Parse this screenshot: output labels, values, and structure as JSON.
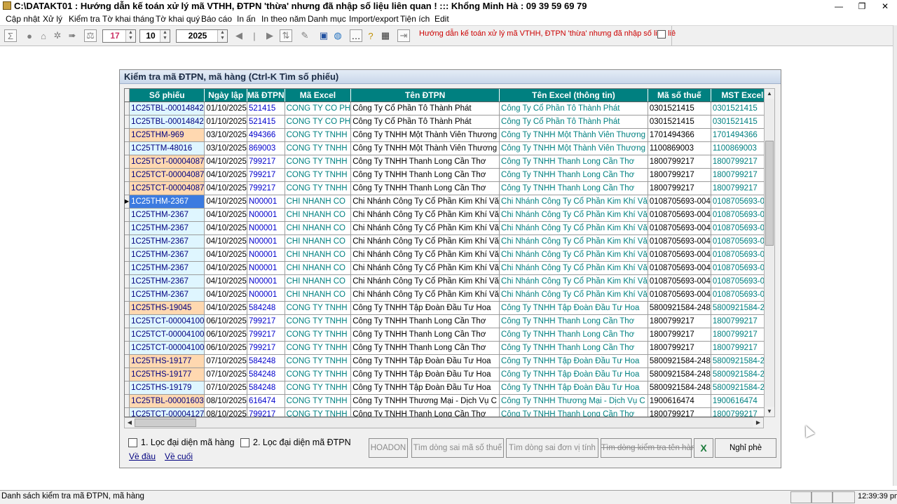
{
  "window": {
    "title": "C:\\DATAKT01 : Hướng dẫn kế toán xử lý mã VTHH, ĐTPN 'thừa' nhưng đã nhập số liệu liên quan ! ::: Khổng Minh Hà : 09 39 59 69 79",
    "minimize": "—",
    "restore": "❐",
    "close": "✕"
  },
  "menu": [
    "Cập nhật",
    "Xử lý",
    "Kiểm tra",
    "Tờ khai tháng",
    "Tờ khai quý",
    "Báo cáo",
    "In ấn",
    "In theo năm",
    "Danh mục",
    "Import/export",
    "Tiện ích",
    "Edit"
  ],
  "toolbar": {
    "day": "17",
    "month": "10",
    "year": "2025",
    "hint": "Hướng dẫn kế toán xử lý mã VTHH, ĐTPN 'thừa' nhưng đã nhập số liệu liê"
  },
  "dialog": {
    "title": "Kiểm tra mã ĐTPN, mã hàng (Ctrl-K Tìm số phiếu)",
    "columns": [
      "Số phiếu",
      "Ngày lập",
      "Mã ĐTPN",
      "Mã Excel",
      "Tên ĐTPN",
      "Tên Excel (thông tin)",
      "Mã số thuế",
      "MST Excel"
    ],
    "rows": [
      [
        "1C25TBL-00014842",
        "01/10/2025",
        "521415",
        "CONG TY CO PH",
        "Công Ty Cổ Phần Tô Thành Phát",
        "Công Ty Cổ Phần Tô Thành Phát",
        "0301521415",
        "0301521415"
      ],
      [
        "1C25TBL-00014842",
        "01/10/2025",
        "521415",
        "CONG TY CO PH",
        "Công Ty Cổ Phần Tô Thành Phát",
        "Công Ty Cổ Phần Tô Thành Phát",
        "0301521415",
        "0301521415"
      ],
      [
        "1C25THM-969",
        "03/10/2025",
        "494366",
        "CONG TY TNHH",
        "Công Ty TNHH Một Thành Viên Thương",
        "Công Ty TNHH Một Thành Viên Thương",
        "1701494366",
        "1701494366"
      ],
      [
        "1C25TTM-48016",
        "03/10/2025",
        "869003",
        "CONG TY TNHH",
        "Công Ty TNHH Một Thành Viên Thương",
        "Công Ty TNHH Một Thành Viên Thương",
        "1100869003",
        "1100869003"
      ],
      [
        "1C25TCT-00004087",
        "04/10/2025",
        "799217",
        "CONG TY TNHH",
        "Công Ty TNHH Thanh Long Cần Thơ",
        "Công Ty TNHH Thanh Long Cần Thơ",
        "1800799217",
        "1800799217"
      ],
      [
        "1C25TCT-00004087",
        "04/10/2025",
        "799217",
        "CONG TY TNHH",
        "Công Ty TNHH Thanh Long Cần Thơ",
        "Công Ty TNHH Thanh Long Cần Thơ",
        "1800799217",
        "1800799217"
      ],
      [
        "1C25TCT-00004087",
        "04/10/2025",
        "799217",
        "CONG TY TNHH",
        "Công Ty TNHH Thanh Long Cần Thơ",
        "Công Ty TNHH Thanh Long Cần Thơ",
        "1800799217",
        "1800799217"
      ],
      [
        "1C25THM-2367",
        "04/10/2025",
        "N00001",
        "CHI NHANH CO",
        "Chi Nhánh Công Ty Cổ Phần Kim Khí Vă",
        "Chi Nhánh Công Ty Cổ Phần Kim Khí Vă",
        "0108705693-004",
        "0108705693-004"
      ],
      [
        "1C25THM-2367",
        "04/10/2025",
        "N00001",
        "CHI NHANH CO",
        "Chi Nhánh Công Ty Cổ Phần Kim Khí Vă",
        "Chi Nhánh Công Ty Cổ Phần Kim Khí Vă",
        "0108705693-004",
        "0108705693-004"
      ],
      [
        "1C25THM-2367",
        "04/10/2025",
        "N00001",
        "CHI NHANH CO",
        "Chi Nhánh Công Ty Cổ Phần Kim Khí Vă",
        "Chi Nhánh Công Ty Cổ Phần Kim Khí Vă",
        "0108705693-004",
        "0108705693-004"
      ],
      [
        "1C25THM-2367",
        "04/10/2025",
        "N00001",
        "CHI NHANH CO",
        "Chi Nhánh Công Ty Cổ Phần Kim Khí Vă",
        "Chi Nhánh Công Ty Cổ Phần Kim Khí Vă",
        "0108705693-004",
        "0108705693-004"
      ],
      [
        "1C25THM-2367",
        "04/10/2025",
        "N00001",
        "CHI NHANH CO",
        "Chi Nhánh Công Ty Cổ Phần Kim Khí Vă",
        "Chi Nhánh Công Ty Cổ Phần Kim Khí Vă",
        "0108705693-004",
        "0108705693-004"
      ],
      [
        "1C25THM-2367",
        "04/10/2025",
        "N00001",
        "CHI NHANH CO",
        "Chi Nhánh Công Ty Cổ Phần Kim Khí Vă",
        "Chi Nhánh Công Ty Cổ Phần Kim Khí Vă",
        "0108705693-004",
        "0108705693-004"
      ],
      [
        "1C25THM-2367",
        "04/10/2025",
        "N00001",
        "CHI NHANH CO",
        "Chi Nhánh Công Ty Cổ Phần Kim Khí Vă",
        "Chi Nhánh Công Ty Cổ Phần Kim Khí Vă",
        "0108705693-004",
        "0108705693-004"
      ],
      [
        "1C25THM-2367",
        "04/10/2025",
        "N00001",
        "CHI NHANH CO",
        "Chi Nhánh Công Ty Cổ Phần Kim Khí Vă",
        "Chi Nhánh Công Ty Cổ Phần Kim Khí Vă",
        "0108705693-004",
        "0108705693-004"
      ],
      [
        "1C25THS-19045",
        "04/10/2025",
        "584248",
        "CONG TY TNHH",
        "Công Ty TNHH Tập Đoàn Đầu Tư Hoa",
        "Công Ty TNHH Tập Đoàn Đầu Tư Hoa",
        "5800921584-248",
        "5800921584-248"
      ],
      [
        "1C25TCT-00004100",
        "06/10/2025",
        "799217",
        "CONG TY TNHH",
        "Công Ty TNHH Thanh Long Cần Thơ",
        "Công Ty TNHH Thanh Long Cần Thơ",
        "1800799217",
        "1800799217"
      ],
      [
        "1C25TCT-00004100",
        "06/10/2025",
        "799217",
        "CONG TY TNHH",
        "Công Ty TNHH Thanh Long Cần Thơ",
        "Công Ty TNHH Thanh Long Cần Thơ",
        "1800799217",
        "1800799217"
      ],
      [
        "1C25TCT-00004100",
        "06/10/2025",
        "799217",
        "CONG TY TNHH",
        "Công Ty TNHH Thanh Long Cần Thơ",
        "Công Ty TNHH Thanh Long Cần Thơ",
        "1800799217",
        "1800799217"
      ],
      [
        "1C25THS-19177",
        "07/10/2025",
        "584248",
        "CONG TY TNHH",
        "Công Ty TNHH Tập Đoàn Đầu Tư Hoa",
        "Công Ty TNHH Tập Đoàn Đầu Tư Hoa",
        "5800921584-248",
        "5800921584-248"
      ],
      [
        "1C25THS-19177",
        "07/10/2025",
        "584248",
        "CONG TY TNHH",
        "Công Ty TNHH Tập Đoàn Đầu Tư Hoa",
        "Công Ty TNHH Tập Đoàn Đầu Tư Hoa",
        "5800921584-248",
        "5800921584-248"
      ],
      [
        "1C25THS-19179",
        "07/10/2025",
        "584248",
        "CONG TY TNHH",
        "Công Ty TNHH Tập Đoàn Đầu Tư Hoa",
        "Công Ty TNHH Tập Đoàn Đầu Tư Hoa",
        "5800921584-248",
        "5800921584-248"
      ],
      [
        "1C25TBL-00001603",
        "08/10/2025",
        "616474",
        "CONG TY TNHH",
        "Công Ty TNHH Thương Mại - Dịch Vụ C",
        "Công Ty TNHH Thương Mại - Dịch Vụ C",
        "1900616474",
        "1900616474"
      ],
      [
        "1C25TCT-00004127",
        "08/10/2025",
        "799217",
        "CONG TY TNHH",
        "Công Ty TNHH Thanh Long Cần Thơ",
        "Công Ty TNHH Thanh Long Cần Thơ",
        "1800799217",
        "1800799217"
      ]
    ],
    "highlighted_rows": [
      2,
      4,
      5,
      6,
      15,
      19,
      20,
      22
    ],
    "selected_row": 7,
    "filter1_label": "1. Lọc đại diện mã hàng",
    "filter2_label": "2. Lọc đại diện mã ĐTPN",
    "link_first": "Về đầu",
    "link_last": "Về cuối",
    "btn_hoadon": "HOADON",
    "btn_find_mst": "Tìm dòng sai mã số thuế",
    "btn_find_unit": "Tìm dòng sai đơn vị tính",
    "btn_find_name": "Tìm dòng kiểm tra tên hàng",
    "btn_excel": "X",
    "btn_close": "Nghỉ phè"
  },
  "status": {
    "text": "Danh sách kiểm tra mã ĐTPN, mã hàng",
    "time": "12:39:39 pm"
  },
  "colors": {
    "header_teal": "#008080",
    "row_highlight": "#ffd8b0",
    "row_normal": "#dff6ff",
    "selection": "#3c7be0",
    "hint_red": "#cc0000"
  }
}
